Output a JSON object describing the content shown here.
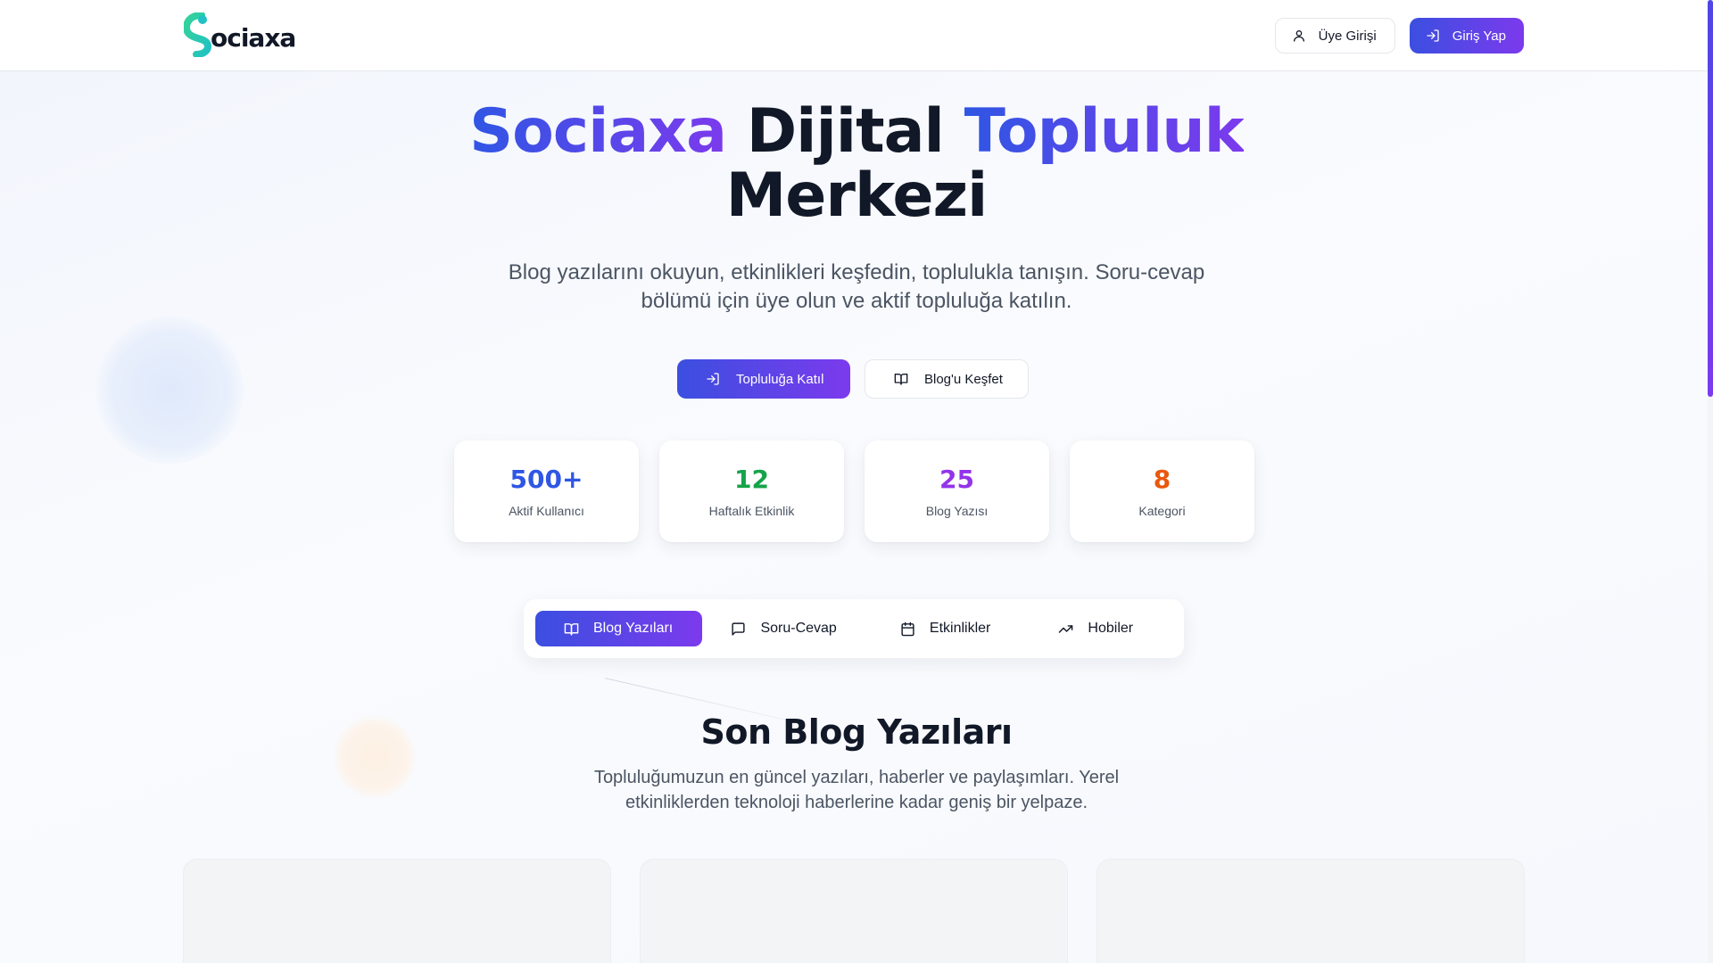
{
  "header": {
    "logo_text": "ociaxa",
    "member_login_label": "Üye Girişi",
    "login_label": "Giriş Yap"
  },
  "hero": {
    "title_part1": "Sociaxa",
    "title_part2": "Dijital",
    "title_part3": "Topluluk",
    "title_part4": "Merkezi",
    "subtitle": "Blog yazılarını okuyun, etkinlikleri keşfedin, toplulukla tanışın. Soru-cevap bölümü için üye olun ve aktif topluluğa katılın.",
    "join_label": "Topluluğa Katıl",
    "explore_label": "Blog'u Keşfet"
  },
  "stats": [
    {
      "value": "500+",
      "label": "Aktif Kullanıcı",
      "color": "#2f56e4"
    },
    {
      "value": "12",
      "label": "Haftalık Etkinlik",
      "color": "#16a34a"
    },
    {
      "value": "25",
      "label": "Blog Yazısı",
      "color": "#9333ea"
    },
    {
      "value": "8",
      "label": "Kategori",
      "color": "#ea580c"
    }
  ],
  "tabs": [
    {
      "label": "Blog Yazıları",
      "icon": "book-open-icon",
      "active": true
    },
    {
      "label": "Soru-Cevap",
      "icon": "message-square-icon",
      "active": false
    },
    {
      "label": "Etkinlikler",
      "icon": "calendar-icon",
      "active": false
    },
    {
      "label": "Hobiler",
      "icon": "trending-up-icon",
      "active": false
    }
  ],
  "section": {
    "title": "Son Blog Yazıları",
    "subtitle": "Topluluğumuzun en güncel yazıları, haberler ve paylaşımları. Yerel etkinliklerden teknoloji haberlerine kadar geniş bir yelpaze."
  },
  "colors": {
    "primary_start": "#3b4fe0",
    "primary_end": "#7c3aed",
    "logo_green": "#34d399",
    "logo_teal": "#2dd4bf"
  }
}
